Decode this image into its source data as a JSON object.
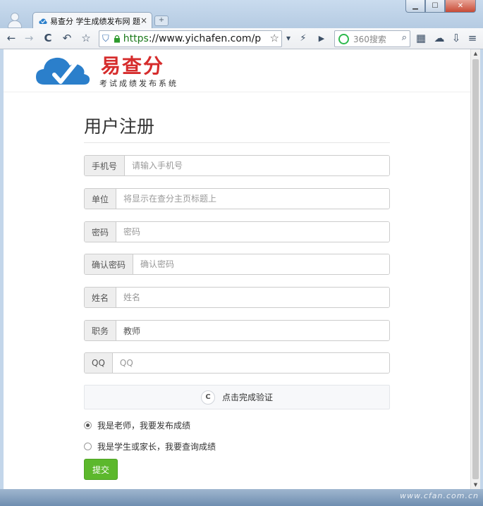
{
  "window": {
    "minimize_glyph": "▁",
    "maximize_glyph": "☐",
    "close_glyph": "✕"
  },
  "tab": {
    "title": "易查分 学生成绩发布网 题",
    "close_glyph": "×",
    "new_tab_glyph": "+"
  },
  "toolbar": {
    "back_icon": "←",
    "forward_icon": "→",
    "reload_icon": "C",
    "undo_icon": "↶",
    "bookmark_icon": "☆",
    "shield_icon": "⛉",
    "url_scheme": "https",
    "url_rest": "://www.yichafen.com/p",
    "url_star": "☆",
    "dropdown_icon": "▾",
    "flash_icon": "⚡",
    "play_icon": "▶",
    "search_placeholder": "360搜索",
    "search_icon": "⌕",
    "apps_icon": "▦",
    "cloud_icon": "☁",
    "download_icon": "⇩",
    "menu_icon": "≡"
  },
  "brand": {
    "name": "易查分",
    "slogan": "考试成绩发布系统",
    "color": "#d62c2c",
    "logo_color": "#2b7fcb"
  },
  "form": {
    "title": "用户注册",
    "fields": [
      {
        "label": "手机号",
        "placeholder": "请输入手机号",
        "value": ""
      },
      {
        "label": "单位",
        "placeholder": "将显示在查分主页标题上",
        "value": ""
      },
      {
        "label": "密码",
        "placeholder": "密码",
        "value": ""
      },
      {
        "label": "确认密码",
        "placeholder": "确认密码",
        "value": ""
      },
      {
        "label": "姓名",
        "placeholder": "姓名",
        "value": ""
      },
      {
        "label": "职务",
        "placeholder": "",
        "value": "教师"
      },
      {
        "label": "QQ",
        "placeholder": "QQ",
        "value": ""
      }
    ],
    "captcha_label": "点击完成验证",
    "captcha_icon": "C",
    "role_options": [
      {
        "label": "我是老师，我要发布成绩",
        "checked": true
      },
      {
        "label": "我是学生或家长，我要查询成绩",
        "checked": false
      }
    ],
    "submit_label": "提交",
    "submit_color": "#5cb82c"
  },
  "scrollbar": {
    "up_glyph": "▲",
    "down_glyph": "▼"
  },
  "watermark": "www.cfan.com.cn"
}
